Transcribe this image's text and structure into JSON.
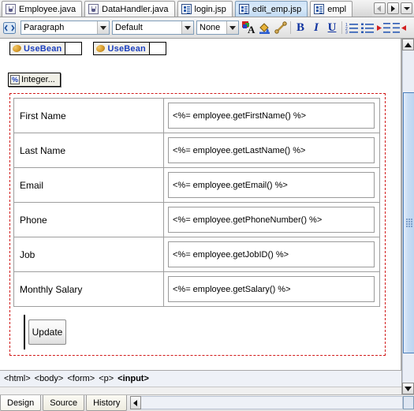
{
  "window": {
    "editor_tabs": [
      {
        "label": "Employee.java",
        "icon": "java-file-icon",
        "active": false
      },
      {
        "label": "DataHandler.java",
        "icon": "java-file-icon",
        "active": false
      },
      {
        "label": "login.jsp",
        "icon": "jsp-file-icon",
        "active": false
      },
      {
        "label": "edit_emp.jsp",
        "icon": "jsp-file-icon",
        "active": true
      },
      {
        "label": "empl",
        "icon": "jsp-file-icon",
        "active": false
      }
    ],
    "tab_nav": {
      "prev": "scroll-tabs-left-icon",
      "next": "scroll-tabs-right-icon",
      "list": "tab-list-dropdown-icon"
    }
  },
  "toolbar": {
    "html_source_icon": "html-toggle-icon",
    "paragraph_style": {
      "value": "Paragraph",
      "placeholder": "Paragraph"
    },
    "font_family": {
      "value": "Default",
      "placeholder": "Default"
    },
    "font_size": {
      "value": "None",
      "placeholder": "None"
    },
    "buttons": [
      {
        "name": "font-color-icon",
        "label": "A"
      },
      {
        "name": "fill-color-icon",
        "label": ""
      },
      {
        "name": "insert-link-icon",
        "label": ""
      },
      {
        "name": "bold-icon",
        "label": "B"
      },
      {
        "name": "italic-icon",
        "label": "I"
      },
      {
        "name": "underline-icon",
        "label": "U"
      },
      {
        "name": "ordered-list-icon",
        "label": ""
      },
      {
        "name": "unordered-list-icon",
        "label": ""
      },
      {
        "name": "indent-icon",
        "label": ""
      },
      {
        "name": "outdent-icon",
        "label": ""
      }
    ]
  },
  "design_view": {
    "usebeans": [
      {
        "label": "UseBean",
        "icon": "bean-icon",
        "value": ""
      },
      {
        "label": "UseBean",
        "icon": "bean-icon",
        "value": ""
      }
    ],
    "scriptlet_chip": {
      "label": "Integer...",
      "icon": "percent-tag-icon"
    },
    "form_rows": [
      {
        "label": "First Name",
        "expression": "<%= employee.getFirstName() %>"
      },
      {
        "label": "Last Name",
        "expression": "<%= employee.getLastName() %>"
      },
      {
        "label": "Email",
        "expression": "<%= employee.getEmail() %>"
      },
      {
        "label": "Phone",
        "expression": "<%= employee.getPhoneNumber() %>"
      },
      {
        "label": "Job",
        "expression": "<%= employee.getJobID() %>"
      },
      {
        "label": "Monthly Salary",
        "expression": "<%= employee.getSalary() %>"
      }
    ],
    "submit_button": "Update"
  },
  "path_bar": {
    "segments": [
      "<html>",
      "<body>",
      "<form>",
      "<p>"
    ],
    "current": "<input>"
  },
  "bottom_tabs": [
    {
      "label": "Design",
      "active": true
    },
    {
      "label": "Source",
      "active": false
    },
    {
      "label": "History",
      "active": false
    }
  ],
  "scrollbar": {
    "up": "scroll-up-arrow-icon",
    "down": "scroll-down-arrow-icon",
    "thumb": "scrollbar-thumb"
  },
  "colors": {
    "accent_blue": "#1b3fbf",
    "selection_dash": "#d11a1a",
    "active_tab": "#cfe3f7"
  }
}
